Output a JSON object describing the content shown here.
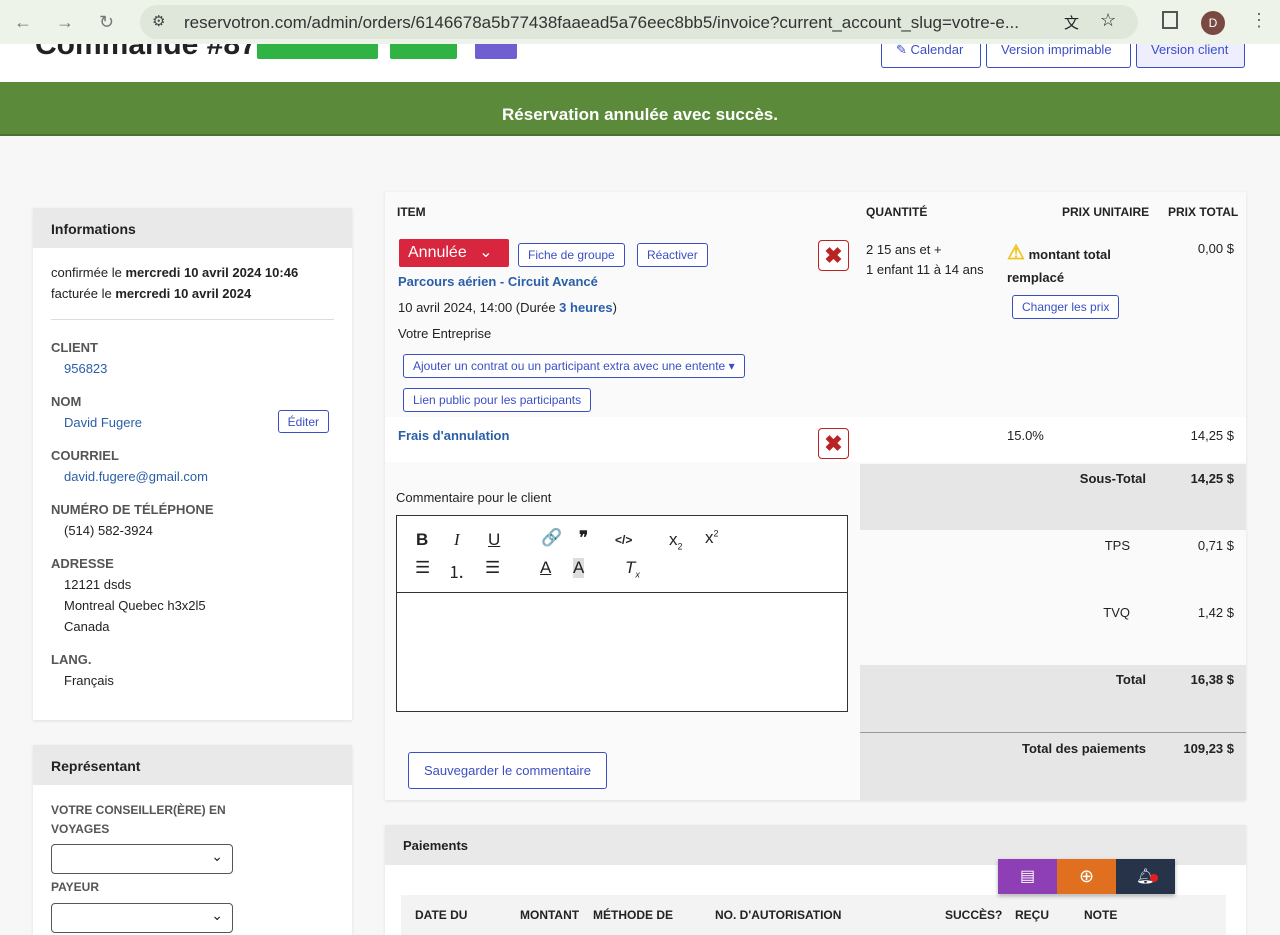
{
  "browser": {
    "url": "reservotron.com/admin/orders/6146678a5b77438faaead5a76eec8bb5/invoice?current_account_slug=votre-e...",
    "avatar": "D"
  },
  "header": {
    "title": "Commande #87",
    "calendar": "Calendar",
    "printable": "Version imprimable",
    "client_version": "Version client"
  },
  "banner": "Réservation annulée avec succès.",
  "info": {
    "title": "Informations",
    "confirmed_prefix": "confirmée le",
    "confirmed_date": "mercredi 10 avril 2024 10:46",
    "billed_prefix": "facturée le",
    "billed_date": "mercredi 10 avril 2024",
    "client_label": "CLIENT",
    "client": "956823",
    "name_label": "NOM",
    "name": "David Fugere",
    "edit": "Éditer",
    "email_label": "COURRIEL",
    "email": "david.fugere@gmail.com",
    "phone_label": "NUMÉRO DE TÉLÉPHONE",
    "phone": "(514) 582-3924",
    "address_label": "ADRESSE",
    "address1": "12121 dsds",
    "address2": "Montreal Quebec h3x2l5",
    "address3": "Canada",
    "lang_label": "LANG.",
    "lang": "Français"
  },
  "rep": {
    "title": "Représentant",
    "advisor_label": "VOTRE CONSEILLER(ÈRE) EN VOYAGES",
    "payer_label": "PAYEUR"
  },
  "items": {
    "headers": {
      "item": "ITEM",
      "qty": "QUANTITÉ",
      "unit": "PRIX UNITAIRE",
      "total": "PRIX TOTAL"
    },
    "status": "Annulée",
    "group_sheet": "Fiche de groupe",
    "reactivate": "Réactiver",
    "product": "Parcours aérien - Circuit Avancé",
    "date": "10 avril 2024, 14:00 (Durée ",
    "duration": "3 heures",
    "date_end": ")",
    "company": "Votre Entreprise",
    "add_contract": "Ajouter un contrat ou un participant extra avec une entente",
    "public_link": "Lien public pour les participants",
    "qty1": "2 15 ans et +",
    "qty2": "1 enfant 11 à 14 ans",
    "price_warning": "montant total remplacé",
    "change_prices": "Changer les prix",
    "line_total": "0,00 $",
    "fee_name": "Frais d'annulation",
    "fee_rate": "15.0%",
    "fee_total": "14,25 $"
  },
  "comment": {
    "label": "Commentaire pour le client",
    "save": "Sauvegarder le commentaire"
  },
  "totals": {
    "subtotal_label": "Sous-Total",
    "subtotal": "14,25 $",
    "tps_label": "TPS",
    "tps": "0,71 $",
    "tvq_label": "TVQ",
    "tvq": "1,42 $",
    "total_label": "Total",
    "total": "16,38 $",
    "payments_label": "Total des paiements",
    "payments": "109,23 $"
  },
  "payments": {
    "title": "Paiements",
    "cols": [
      "DATE DU",
      "MONTANT",
      "MÉTHODE DE",
      "NO. D'AUTORISATION",
      "SUCCÈS?",
      "REÇU",
      "NOTE"
    ]
  },
  "colors": {
    "banner": "#5b8b3a",
    "accent": "#3b4fc4",
    "danger": "#d7263d"
  }
}
